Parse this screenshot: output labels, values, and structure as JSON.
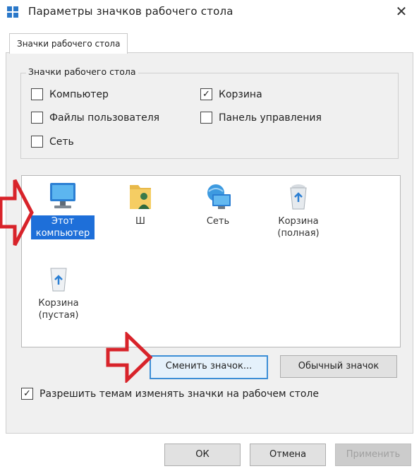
{
  "window": {
    "title": "Параметры значков рабочего стола",
    "close_glyph": "✕"
  },
  "tab": {
    "label": "Значки рабочего стола"
  },
  "group": {
    "legend": "Значки рабочего стола",
    "checkboxes": [
      {
        "label": "Компьютер",
        "checked": false
      },
      {
        "label": "Корзина",
        "checked": true
      },
      {
        "label": "Файлы пользователя",
        "checked": false
      },
      {
        "label": "Панель управления",
        "checked": false
      },
      {
        "label": "Сеть",
        "checked": false
      }
    ]
  },
  "icons": [
    {
      "label": "Этот компьютер",
      "icon": "computer-icon",
      "selected": true
    },
    {
      "label": "Ш",
      "icon": "user-folder-icon",
      "selected": false
    },
    {
      "label": "Сеть",
      "icon": "network-icon",
      "selected": false
    },
    {
      "label": "Корзина (полная)",
      "icon": "recycle-bin-full-icon",
      "selected": false
    },
    {
      "label": "Корзина (пустая)",
      "icon": "recycle-bin-empty-icon",
      "selected": false
    }
  ],
  "buttons": {
    "change_icon": "Сменить значок...",
    "default_icon": "Обычный значок",
    "ok": "ОК",
    "cancel": "Отмена",
    "apply": "Применить"
  },
  "allow_themes": {
    "label": "Разрешить темам изменять значки на рабочем столе",
    "checked": true
  },
  "colors": {
    "accent": "#1e6fd9",
    "annotation_arrow": "#d8232a",
    "dialog_bg": "#f0f0f0"
  }
}
